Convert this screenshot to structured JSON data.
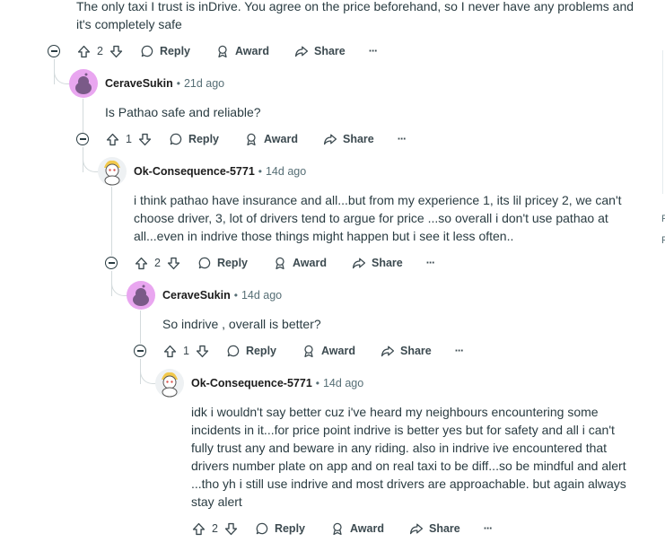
{
  "comments": [
    {
      "id": "c0",
      "body": [
        "The only taxi I trust is inDrive. You agree on the price beforehand, so I never have any problems and",
        "it's completely safe"
      ],
      "votes": "2"
    },
    {
      "id": "c1",
      "username": "CeraveSukin",
      "time": "21d ago",
      "body": [
        "Is Pathao safe and reliable?"
      ],
      "votes": "1"
    },
    {
      "id": "c2",
      "username": "Ok-Consequence-5771",
      "time": "14d ago",
      "body": [
        "i think pathao have insurance and all...but from my experience 1, its lil pricey 2, we can't",
        "choose driver, 3, lot of drivers tend to argue for price ...so overall i don't use pathao at",
        "all...even in indrive those things might happen but i see it less often.."
      ],
      "votes": "2"
    },
    {
      "id": "c3",
      "username": "CeraveSukin",
      "time": "14d ago",
      "body": [
        "So indrive , overall is better?"
      ],
      "votes": "1"
    },
    {
      "id": "c4",
      "username": "Ok-Consequence-5771",
      "time": "14d ago",
      "body": [
        "idk i wouldn't say better cuz i've heard my neighbours encountering some",
        "incidents in it...for price point indrive is better yes but for safety and all i can't",
        "fully trust any and beware in any riding. also in indrive ive encountered that",
        "drivers number plate on app and on real taxi to be diff...so be mindful and alert",
        "...tho yh i still use indrive and most drivers are approachable. but again always",
        "stay alert"
      ],
      "votes": "2"
    }
  ],
  "actions": {
    "reply": "Reply",
    "award": "Award",
    "share": "Share",
    "more": "···"
  },
  "sidebar_edge": [
    "F",
    "F"
  ]
}
